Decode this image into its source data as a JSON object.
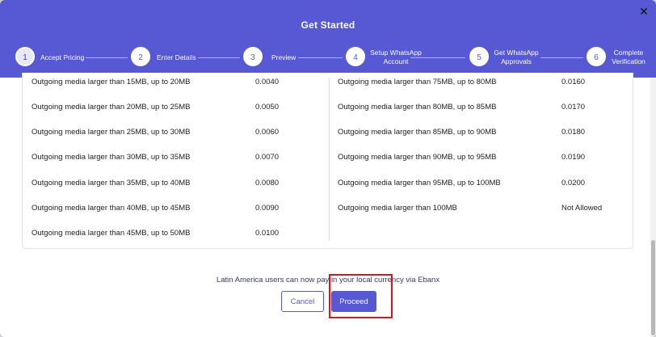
{
  "modal": {
    "title": "Get Started",
    "close_glyph": "✕"
  },
  "steps": [
    {
      "number": "1",
      "label": "Accept Pricing"
    },
    {
      "number": "2",
      "label": "Enter Details"
    },
    {
      "number": "3",
      "label": "Preview"
    },
    {
      "number": "4",
      "label_line1": "Setup WhatsApp",
      "label_line2": "Account"
    },
    {
      "number": "5",
      "label_line1": "Get WhatsApp",
      "label_line2": "Approvals"
    },
    {
      "number": "6",
      "label_line1": "Complete",
      "label_line2": "Verification"
    }
  ],
  "pricing_table": {
    "left": [
      {
        "item": "Outgoing media larger than 15MB, up to 20MB",
        "price": "0.0040"
      },
      {
        "item": "Outgoing media larger than 20MB, up to 25MB",
        "price": "0.0050"
      },
      {
        "item": "Outgoing media larger than 25MB, up to 30MB",
        "price": "0.0060"
      },
      {
        "item": "Outgoing media larger than 30MB, up to 35MB",
        "price": "0.0070"
      },
      {
        "item": "Outgoing media larger than 35MB, up to 40MB",
        "price": "0.0080"
      },
      {
        "item": "Outgoing media larger than 40MB, up to 45MB",
        "price": "0.0090"
      },
      {
        "item": "Outgoing media larger than 45MB, up to 50MB",
        "price": "0.0100"
      }
    ],
    "right": [
      {
        "item": "Outgoing media larger than 75MB, up to 80MB",
        "price": "0.0160"
      },
      {
        "item": "Outgoing media larger than 80MB, up to 85MB",
        "price": "0.0170"
      },
      {
        "item": "Outgoing media larger than 85MB, up to 90MB",
        "price": "0.0180"
      },
      {
        "item": "Outgoing media larger than 90MB, up to 95MB",
        "price": "0.0190"
      },
      {
        "item": "Outgoing media larger than 95MB, up to 100MB",
        "price": "0.0200"
      },
      {
        "item": "Outgoing media larger than 100MB",
        "price": "Not Allowed"
      }
    ]
  },
  "footer": {
    "notice": "Latin America users can now pay in your local currency via Ebanx",
    "cancel_label": "Cancel",
    "proceed_label": "Proceed"
  },
  "colors": {
    "accent": "#5658d4",
    "highlight": "#e0141a"
  }
}
